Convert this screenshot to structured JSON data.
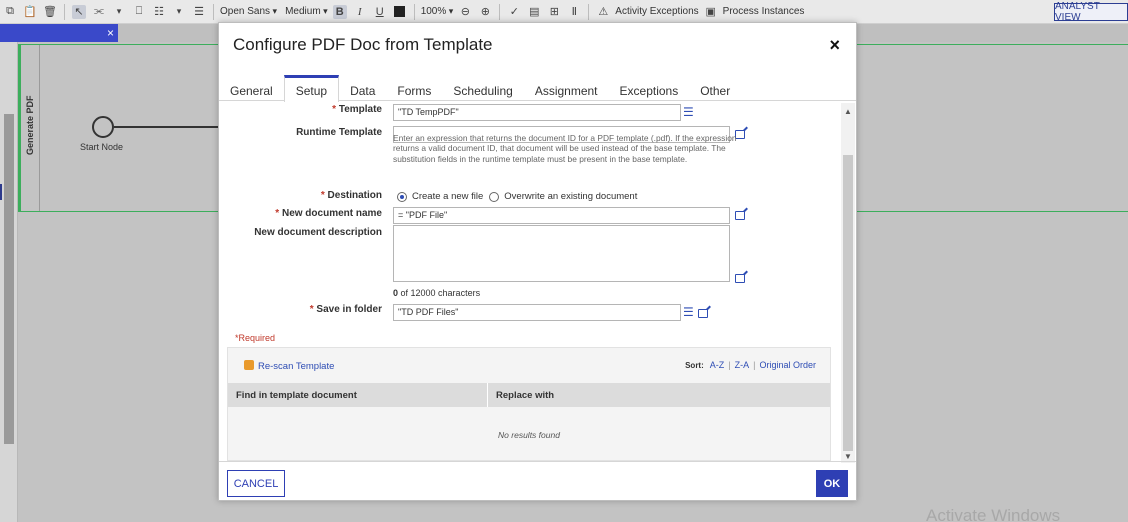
{
  "toolbar": {
    "font_family": "Open Sans",
    "font_size": "Medium",
    "bold": "B",
    "italic": "I",
    "underline": "U",
    "zoom": "100%",
    "activity_exceptions": "Activity Exceptions",
    "process_instances": "Process Instances",
    "analyst_view": "ANALYST VIEW"
  },
  "background": {
    "panel_close": "×",
    "lane_title": "Generate PDF",
    "start_node_label": "Start Node",
    "watermark": "Activate Windows"
  },
  "modal": {
    "title": "Configure PDF Doc from Template",
    "close": "×",
    "tabs": [
      {
        "label": "General"
      },
      {
        "label": "Setup"
      },
      {
        "label": "Data"
      },
      {
        "label": "Forms"
      },
      {
        "label": "Scheduling"
      },
      {
        "label": "Assignment"
      },
      {
        "label": "Exceptions"
      },
      {
        "label": "Other"
      }
    ],
    "active_tab": "Setup"
  },
  "form": {
    "template": {
      "label": "Template",
      "value": "\"TD TempPDF\""
    },
    "runtime_template": {
      "label": "Runtime Template",
      "value": "",
      "help": "Enter an expression that returns the document ID for a PDF template (.pdf). If the expression returns a valid document ID, that document will be used instead of the base template. The substitution fields in the runtime template must be present in the base template."
    },
    "destination": {
      "label": "Destination",
      "option_new": "Create a new file",
      "option_overwrite": "Overwrite an existing document",
      "selected": "Create a new file"
    },
    "new_doc_name": {
      "label": "New document name",
      "value": "= \"PDF File\""
    },
    "new_doc_description": {
      "label": "New document description",
      "value": "",
      "count": "0",
      "count_suffix": " of 12000 characters"
    },
    "save_in_folder": {
      "label": "Save in folder",
      "value": "\"TD  PDF Files\""
    },
    "required_asterisk": "*",
    "required_note": "*Required"
  },
  "mapping": {
    "rescan": "Re-scan Template",
    "sort_label": "Sort:",
    "sort_az": "A-Z",
    "sort_za": "Z-A",
    "sort_original": "Original Order",
    "sort_sep": "|",
    "col_find": "Find in template document",
    "col_replace": "Replace with",
    "empty": "No results found"
  },
  "footer": {
    "cancel": "CANCEL",
    "ok": "OK"
  },
  "colors": {
    "accent": "#2e3fb4",
    "lane": "#3cae5c",
    "required": "#c0392b"
  }
}
